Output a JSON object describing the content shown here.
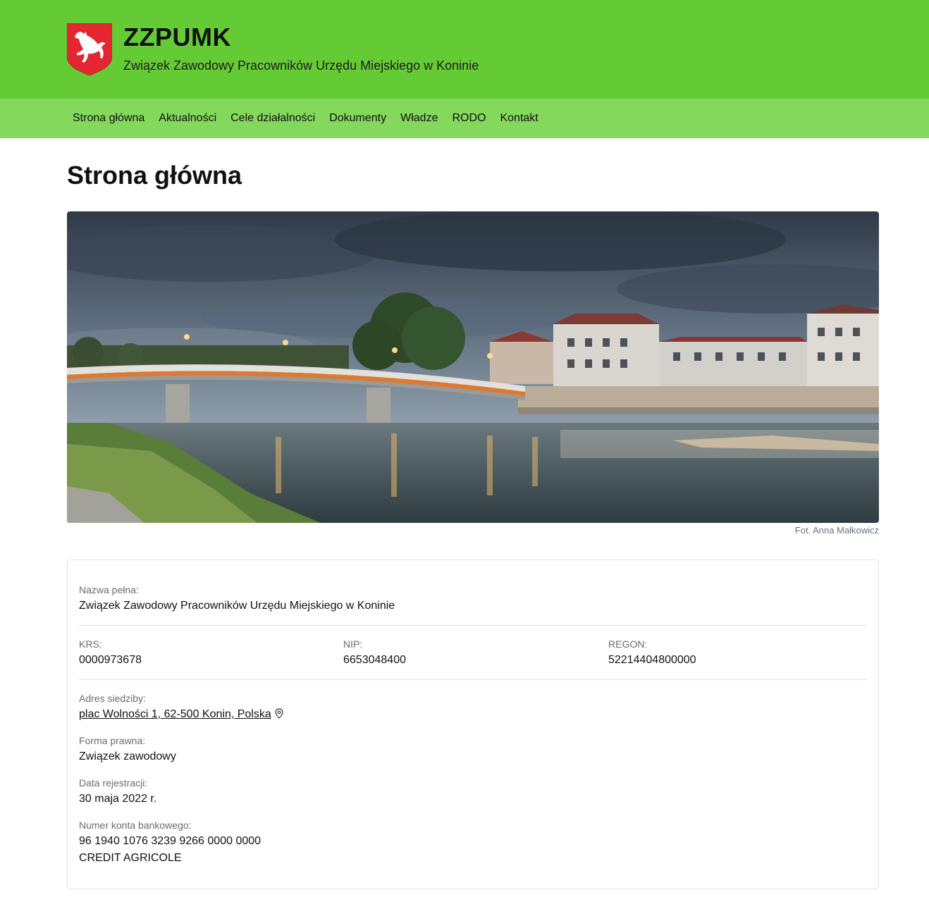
{
  "header": {
    "title": "ZZPUMK",
    "subtitle": "Związek Zawodowy Pracowników Urzędu Miejskiego w Koninie",
    "bg_color": "#65cb35"
  },
  "nav": {
    "bg_color": "#84d85c",
    "items": [
      {
        "label": "Strona główna"
      },
      {
        "label": "Aktualności"
      },
      {
        "label": "Cele działalności"
      },
      {
        "label": "Dokumenty"
      },
      {
        "label": "Władze"
      },
      {
        "label": "RODO"
      },
      {
        "label": "Kontakt"
      }
    ]
  },
  "page": {
    "title": "Strona główna",
    "photo_caption": "Fot. Anna Małkowicz"
  },
  "info": {
    "full_name_label": "Nazwa pełna:",
    "full_name": "Związek Zawodowy Pracowników Urzędu Miejskiego w Koninie",
    "krs_label": "KRS:",
    "krs": "0000973678",
    "nip_label": "NIP:",
    "nip": "6653048400",
    "regon_label": "REGON:",
    "regon": "52214404800000",
    "address_label": "Adres siedziby:",
    "address": "plac Wolności 1, 62-500 Konin, Polska",
    "legal_form_label": "Forma prawna:",
    "legal_form": "Związek zawodowy",
    "reg_date_label": "Data rejestracji:",
    "reg_date": "30 maja 2022 r.",
    "bank_label": "Numer konta bankowego:",
    "bank_account": "96 1940 1076 3239 9266 0000 0000",
    "bank_name": "CREDIT AGRICOLE"
  }
}
